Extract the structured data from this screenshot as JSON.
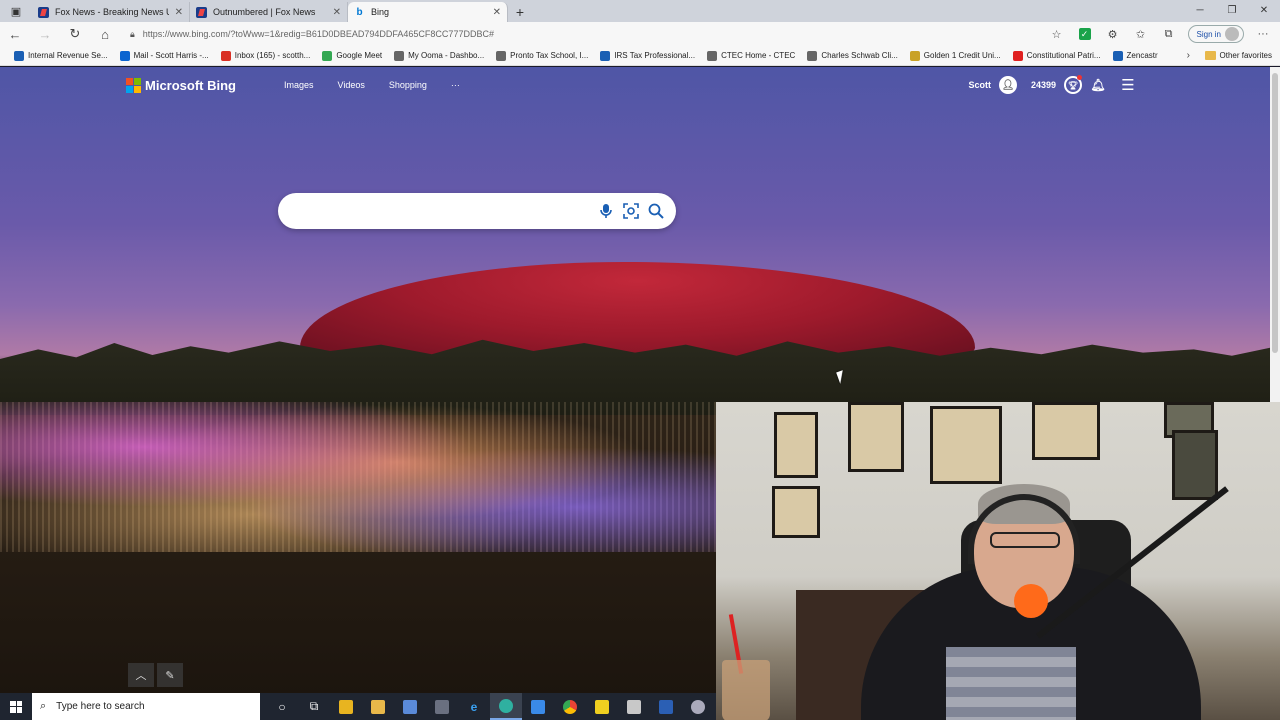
{
  "browser": {
    "tabs": [
      {
        "title": "Fox News - Breaking News Upda",
        "favicon": "foxnews-icon"
      },
      {
        "title": "Outnumbered | Fox News",
        "favicon": "foxnews-icon"
      },
      {
        "title": "Bing",
        "favicon": "bing-icon",
        "active": true
      }
    ],
    "url": "https://www.bing.com/?toWww=1&redig=B61D0DBEAD794DDFA465CF8CC777DDBC#",
    "signin_label": "Sign in",
    "bookmarks": [
      {
        "label": "Internal Revenue Se...",
        "color": "#1a5fb4"
      },
      {
        "label": "Mail - Scott Harris -...",
        "color": "#0a64d0"
      },
      {
        "label": "Inbox (165) - scotth...",
        "color": "#d93025"
      },
      {
        "label": "Google Meet",
        "color": "#34a853"
      },
      {
        "label": "My Ooma - Dashbo...",
        "color": "#666666"
      },
      {
        "label": "Pronto Tax School, I...",
        "color": "#666666"
      },
      {
        "label": "IRS Tax Professional...",
        "color": "#1a5fb4"
      },
      {
        "label": "CTEC Home - CTEC",
        "color": "#666666"
      },
      {
        "label": "Charles Schwab Cli...",
        "color": "#666666"
      },
      {
        "label": "Golden 1 Credit Uni...",
        "color": "#c9a227"
      },
      {
        "label": "Constitutional Patri...",
        "color": "#e02020"
      },
      {
        "label": "Zencastr",
        "color": "#1a5fb4"
      }
    ],
    "other_favorites": "Other favorites"
  },
  "bing": {
    "brand": "Microsoft Bing",
    "nav": [
      "Images",
      "Videos",
      "Shopping",
      "···"
    ],
    "user_name": "Scott",
    "points": "24399",
    "search_placeholder": ""
  },
  "taskbar": {
    "search_placeholder": "Type here to search"
  },
  "colors": {
    "bing_blue": "#1a5fb4",
    "ms_red": "#f25022",
    "ms_green": "#7fba00",
    "ms_blue": "#00a4ef",
    "ms_yellow": "#ffb900"
  }
}
